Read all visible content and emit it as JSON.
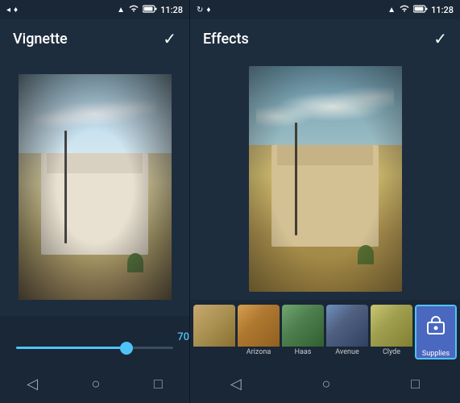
{
  "left": {
    "statusBar": {
      "time": "11:28",
      "icons": [
        "signal",
        "wifi",
        "battery"
      ]
    },
    "topBar": {
      "title": "Vignette",
      "checkLabel": "✓"
    },
    "photo": {
      "alt": "Vignette photo of building"
    },
    "slider": {
      "value": "70",
      "fillPercent": 70
    },
    "bottomNav": {
      "back": "◁",
      "home": "○",
      "recent": "□"
    }
  },
  "right": {
    "statusBar": {
      "time": "11:28",
      "icons": [
        "signal",
        "wifi",
        "battery"
      ]
    },
    "topBar": {
      "title": "Effects",
      "checkLabel": "✓"
    },
    "photo": {
      "alt": "Effects photo of building"
    },
    "effectStrip": {
      "items": [
        {
          "id": "dusty",
          "label": "",
          "active": false
        },
        {
          "id": "arizona",
          "label": "Arizona",
          "active": false
        },
        {
          "id": "haas",
          "label": "Haas",
          "active": false
        },
        {
          "id": "avenue",
          "label": "Avenue",
          "active": false
        },
        {
          "id": "clyde",
          "label": "Clyde",
          "active": false
        },
        {
          "id": "supplies",
          "label": "Supplies",
          "active": true
        }
      ]
    },
    "bottomNav": {
      "back": "◁",
      "home": "○",
      "recent": "□"
    }
  }
}
